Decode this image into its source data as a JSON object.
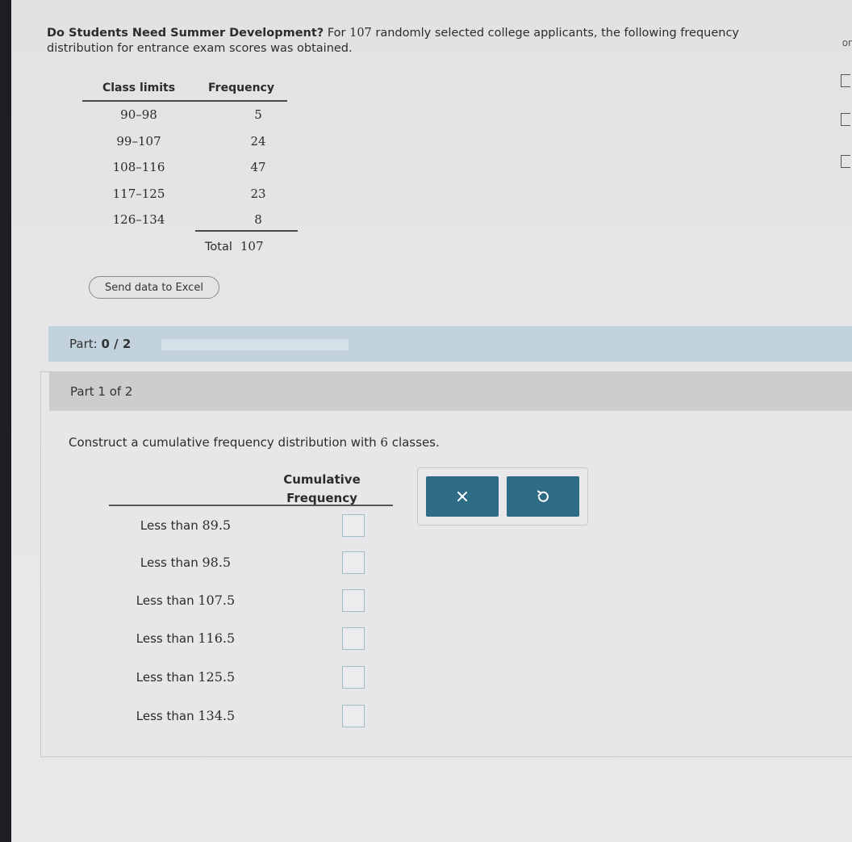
{
  "problem": {
    "title": "Do Students Need Summer Development?",
    "text_pre": " For ",
    "count": "107",
    "text_post": " randomly selected college applicants, the following frequency distribution for entrance exam scores was obtained."
  },
  "freq_table": {
    "headers": [
      "Class limits",
      "Frequency"
    ],
    "rows": [
      {
        "limits": "90–98",
        "freq": "5"
      },
      {
        "limits": "99–107",
        "freq": "24"
      },
      {
        "limits": "108–116",
        "freq": "47"
      },
      {
        "limits": "117–125",
        "freq": "23"
      },
      {
        "limits": "126–134",
        "freq": "8"
      }
    ],
    "total_label": "Total",
    "total_value": "107"
  },
  "excel_button": "Send data to Excel",
  "progress_bar": {
    "label": "Part:",
    "value": "0 / 2",
    "fraction": 0
  },
  "part_panel": {
    "header": "Part 1 of 2",
    "instruction_pre": "Construct a cumulative frequency distribution with ",
    "classes": "6",
    "instruction_post": " classes.",
    "column_header_line1": "Cumulative",
    "column_header_line2": "Frequency",
    "rows": [
      {
        "prefix": "Less than ",
        "bound": "89.5",
        "answer": ""
      },
      {
        "prefix": "Less than ",
        "bound": "98.5",
        "answer": ""
      },
      {
        "prefix": "Less than ",
        "bound": "107.5",
        "answer": ""
      },
      {
        "prefix": "Less than ",
        "bound": "116.5",
        "answer": ""
      },
      {
        "prefix": "Less than ",
        "bound": "125.5",
        "answer": ""
      },
      {
        "prefix": "Less than ",
        "bound": "134.5",
        "answer": ""
      }
    ]
  },
  "tools": {
    "clear_icon": "close-icon",
    "undo_icon": "undo-icon"
  },
  "edge_text": "or",
  "colors": {
    "accent_button": "#2e6c86",
    "progress_bar_bg": "#c3d3dd",
    "part_header_bg": "#cdcdcf"
  }
}
